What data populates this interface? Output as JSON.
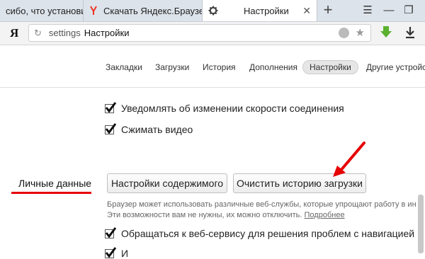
{
  "tabs": [
    {
      "label": "сибо, что установили Я",
      "favicon": "yandex-icon"
    },
    {
      "label": "Скачать Яндекс.Браузер",
      "favicon": "yandex-y-icon"
    },
    {
      "label": "Настройки",
      "favicon": "gear-icon",
      "active": true
    }
  ],
  "navbar": {
    "logo": "Я",
    "url_proto": "settings",
    "url_title": "Настройки"
  },
  "settings_nav": {
    "items": [
      "Закладки",
      "Загрузки",
      "История",
      "Дополнения",
      "Настройки",
      "Другие устройств"
    ],
    "active": "Настройки"
  },
  "options": [
    {
      "label": "Уведомлять об изменении скорости соединения",
      "checked": true
    },
    {
      "label": "Сжимать видео",
      "checked": true
    },
    {
      "label": "Обращаться к веб-сервису для решения проблем с навигацией",
      "checked": true
    },
    {
      "label": "И",
      "checked": true
    }
  ],
  "personal": {
    "section_label": "Личные данные",
    "content_settings_button": "Настройки содержимого",
    "clear_history_button": "Очистить историю загрузки",
    "note_line1": "Браузер может использовать различные веб-службы, которые упрощают работу в ин",
    "note_line2": "Эти возможности вам не нужны, их можно отключить. ",
    "note_more": "Подробнее"
  },
  "colors": {
    "accent_red": "#e60000",
    "tab_strip": "#dde3ea"
  }
}
